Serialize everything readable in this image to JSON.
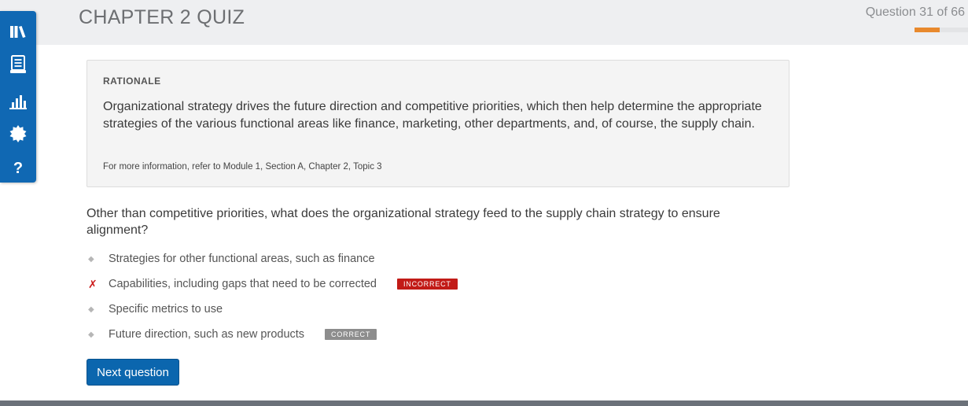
{
  "header": {
    "title": "CHAPTER 2 QUIZ",
    "progress_text": "Question 31 of 66",
    "progress_fraction": 0.47,
    "accent_color": "#e8892d"
  },
  "sidebar": {
    "items": [
      {
        "icon": "library-icon"
      },
      {
        "icon": "notebook-icon"
      },
      {
        "icon": "bar-chart-icon"
      },
      {
        "icon": "badge-icon"
      },
      {
        "icon": "help-icon",
        "glyph": "?"
      }
    ],
    "color": "#1068b3"
  },
  "rationale": {
    "heading": "RATIONALE",
    "text": "Organizational strategy drives the future direction and competitive priorities, which then help determine the appropriate strategies of the various functional areas like finance, marketing, other departments, and, of course, the supply chain.",
    "reference": "For more information, refer to Module 1, Section A, Chapter 2, Topic 3"
  },
  "question": {
    "text": "Other than competitive priorities, what does the organizational strategy feed to the supply chain strategy to ensure alignment?"
  },
  "answers": [
    {
      "label": "Strategies for other functional areas, such as finance",
      "marker": "◆",
      "status": "",
      "badge": ""
    },
    {
      "label": "Capabilities, including gaps that need to be corrected",
      "marker": "✗",
      "status": "incorrect",
      "badge": "INCORRECT"
    },
    {
      "label": "Specific metrics to use",
      "marker": "◆",
      "status": "",
      "badge": ""
    },
    {
      "label": "Future direction, such as new products",
      "marker": "◆",
      "status": "correct",
      "badge": "CORRECT"
    }
  ],
  "next_button": {
    "label": "Next question"
  }
}
